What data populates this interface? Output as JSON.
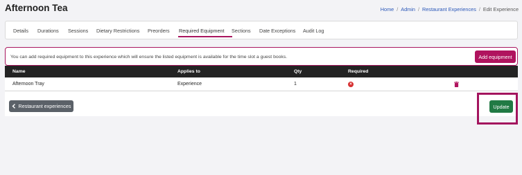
{
  "page": {
    "title": "Afternoon Tea"
  },
  "breadcrumb": {
    "items": [
      "Home",
      "Admin",
      "Restaurant Experiences"
    ],
    "separator": "/",
    "current": "Edit Experience"
  },
  "tabs": [
    {
      "label": "Details"
    },
    {
      "label": "Durations"
    },
    {
      "label": "Sessions"
    },
    {
      "label": "Dietary Restrictions"
    },
    {
      "label": "Preorders"
    },
    {
      "label": "Required Equipment",
      "active": true
    },
    {
      "label": "Sections"
    },
    {
      "label": "Date Exceptions"
    },
    {
      "label": "Audit Log"
    }
  ],
  "info": {
    "text": "You can add required equipment to this experience which will ensure the listed equipment is available for the time slot a guest books.",
    "add_button": "Add equipment"
  },
  "table": {
    "headers": {
      "name": "Name",
      "applies_to": "Applies to",
      "qty": "Qty",
      "required": "Required"
    },
    "rows": [
      {
        "name": "Afternoon Tray",
        "applies_to": "Experience",
        "qty": "1",
        "required": false
      }
    ]
  },
  "actions": {
    "back_label": "Restaurant experiences",
    "update_label": "Update"
  },
  "colors": {
    "accent": "#a8155e",
    "update": "#217a44",
    "back": "#5b6168",
    "required_no": "#d63031"
  },
  "icons": {
    "back": "chevron-left-icon",
    "required": "x-circle-icon",
    "delete": "trash-icon"
  }
}
